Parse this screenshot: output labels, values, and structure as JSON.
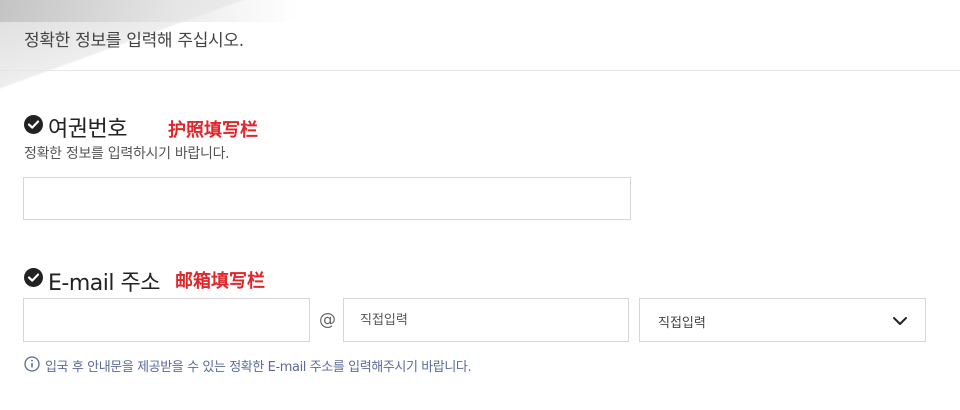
{
  "intro_text": "정확한 정보를 입력해 주십시오.",
  "passport": {
    "label": "여권번호",
    "annotation": "护照填写栏",
    "helper": "정확한 정보를 입력하시기 바랍니다.",
    "value": ""
  },
  "email": {
    "label": "E-mail 주소",
    "annotation": "邮箱填写栏",
    "local_value": "",
    "at_symbol": "@",
    "domain_placeholder": "직접입력",
    "domain_select_value": "직접입력",
    "notice": "입국 후 안내문을 제공받을 수 있는 정확한 E-mail 주소를 입력해주시기 바랍니다."
  },
  "icons": {
    "required": "check-circle-icon",
    "dropdown": "chevron-down-icon",
    "info": "info-circle-icon"
  },
  "colors": {
    "annotation": "#e0262b",
    "notice": "#5a6b9a",
    "border": "#d7d7d7"
  }
}
